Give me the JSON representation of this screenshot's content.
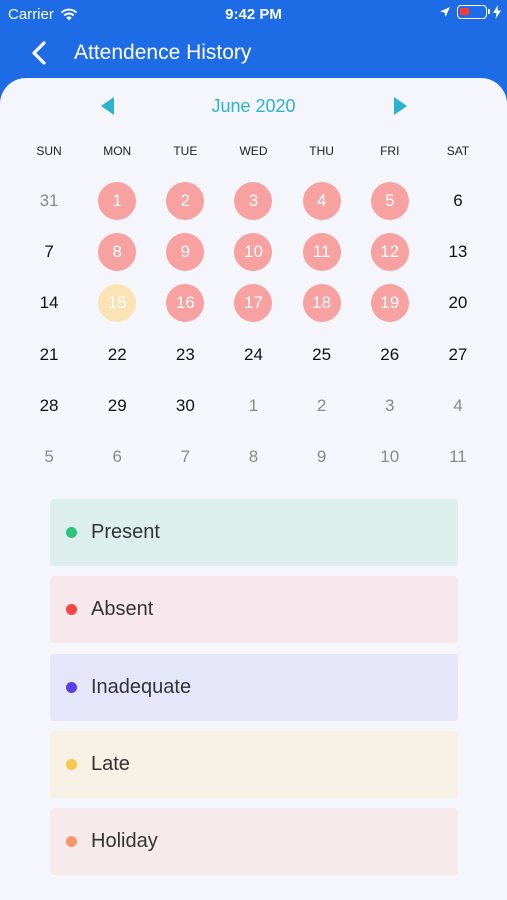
{
  "status_bar": {
    "carrier": "Carrier",
    "time": "9:42 PM"
  },
  "nav": {
    "title": "Attendence History"
  },
  "calendar": {
    "month_label": "June 2020",
    "weekdays": [
      "SUN",
      "MON",
      "TUE",
      "WED",
      "THU",
      "FRI",
      "SAT"
    ],
    "days": [
      {
        "d": "31",
        "s": "muted"
      },
      {
        "d": "1",
        "s": "absent"
      },
      {
        "d": "2",
        "s": "absent"
      },
      {
        "d": "3",
        "s": "absent"
      },
      {
        "d": "4",
        "s": "absent"
      },
      {
        "d": "5",
        "s": "absent"
      },
      {
        "d": "6",
        "s": "normal"
      },
      {
        "d": "7",
        "s": "normal"
      },
      {
        "d": "8",
        "s": "absent"
      },
      {
        "d": "9",
        "s": "absent"
      },
      {
        "d": "10",
        "s": "absent"
      },
      {
        "d": "11",
        "s": "absent"
      },
      {
        "d": "12",
        "s": "absent"
      },
      {
        "d": "13",
        "s": "normal"
      },
      {
        "d": "14",
        "s": "normal"
      },
      {
        "d": "15",
        "s": "late"
      },
      {
        "d": "16",
        "s": "absent"
      },
      {
        "d": "17",
        "s": "absent"
      },
      {
        "d": "18",
        "s": "absent"
      },
      {
        "d": "19",
        "s": "absent"
      },
      {
        "d": "20",
        "s": "normal"
      },
      {
        "d": "21",
        "s": "normal"
      },
      {
        "d": "22",
        "s": "normal"
      },
      {
        "d": "23",
        "s": "normal"
      },
      {
        "d": "24",
        "s": "normal"
      },
      {
        "d": "25",
        "s": "normal"
      },
      {
        "d": "26",
        "s": "normal"
      },
      {
        "d": "27",
        "s": "normal"
      },
      {
        "d": "28",
        "s": "normal"
      },
      {
        "d": "29",
        "s": "normal"
      },
      {
        "d": "30",
        "s": "normal"
      },
      {
        "d": "1",
        "s": "muted"
      },
      {
        "d": "2",
        "s": "muted"
      },
      {
        "d": "3",
        "s": "muted"
      },
      {
        "d": "4",
        "s": "muted"
      },
      {
        "d": "5",
        "s": "muted"
      },
      {
        "d": "6",
        "s": "muted"
      },
      {
        "d": "7",
        "s": "muted"
      },
      {
        "d": "8",
        "s": "muted"
      },
      {
        "d": "9",
        "s": "muted"
      },
      {
        "d": "10",
        "s": "muted"
      },
      {
        "d": "11",
        "s": "muted"
      }
    ]
  },
  "legend": [
    {
      "label": "Present",
      "dot": "#2EC27E",
      "bg": "#DCEFEC"
    },
    {
      "label": "Absent",
      "dot": "#F04747",
      "bg": "#F6E8EC"
    },
    {
      "label": "Inadequate",
      "dot": "#5B3FE6",
      "bg": "#E6E6FA"
    },
    {
      "label": "Late",
      "dot": "#F7C74F",
      "bg": "#F6F0E5"
    },
    {
      "label": "Holiday",
      "dot": "#F79A6B",
      "bg": "#F6EAEB"
    }
  ],
  "colors": {
    "brand": "#1E6BE6",
    "accent": "#2BB3CC",
    "absent_fill": "#F7A1A1",
    "late_fill": "#FBE3B6"
  }
}
